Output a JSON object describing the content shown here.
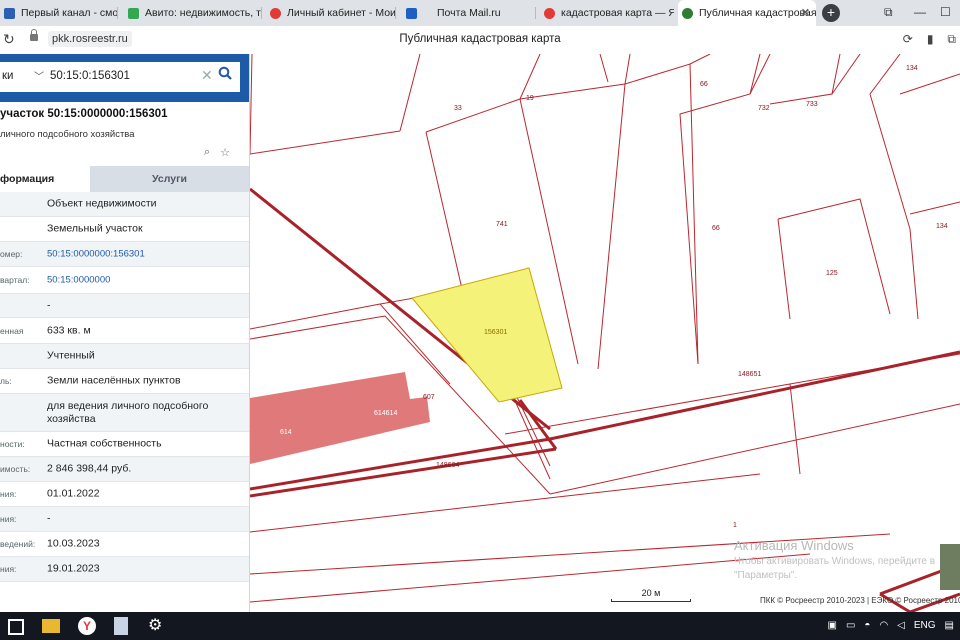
{
  "browser": {
    "tabs": [
      {
        "label": "Первый канал - смо",
        "color": "#2b5fb4"
      },
      {
        "label": "Авито: недвижимость, тр",
        "color": "#33a852"
      },
      {
        "label": "Личный кабинет - Мои о",
        "color": "#e03b3b"
      },
      {
        "label": "Почта Mail.ru",
        "color": "#1f5fc4"
      },
      {
        "label": "кадастровая карта — Янд",
        "color": "#e53935"
      },
      {
        "label": "Публичная кадастровая",
        "color": "#2e7d32",
        "active": true
      }
    ],
    "url": "pkk.rosreestr.ru",
    "page_title": "Публичная кадастровая карта"
  },
  "search": {
    "type_label": "ки",
    "value": "50:15:0:156301"
  },
  "object": {
    "title": "участок 50:15:0000000:156301",
    "subtitle": "личного подсобного хозяйства"
  },
  "panel_tabs": {
    "info": "формация",
    "services": "Услуги"
  },
  "rows": [
    {
      "label": "",
      "value": "Объект недвижимости",
      "link": false,
      "h": 25
    },
    {
      "label": "",
      "value": "Земельный участок",
      "link": false,
      "h": 25
    },
    {
      "label": "омер:",
      "value": "50:15:0000000:156301",
      "link": true,
      "h": 25
    },
    {
      "label": "вартал:",
      "value": "50:15:0000000",
      "link": true,
      "h": 27
    },
    {
      "label": "",
      "value": "-",
      "link": false,
      "h": 24
    },
    {
      "label": "енная",
      "value": "633 кв. м",
      "link": false,
      "h": 26
    },
    {
      "label": "",
      "value": "Учтенный",
      "link": false,
      "h": 25
    },
    {
      "label": "ль:",
      "value": "Земли населённых пунктов",
      "link": false,
      "h": 25
    },
    {
      "label": "",
      "value": "для ведения личного подсобного хозяйства",
      "link": false,
      "h": 38
    },
    {
      "label": "ности:",
      "value": "Частная собственность",
      "link": false,
      "h": 25
    },
    {
      "label": "имость:",
      "value": "2 846 398,44 руб.",
      "link": false,
      "h": 25
    },
    {
      "label": "ния:",
      "value": "01.01.2022",
      "link": false,
      "h": 25
    },
    {
      "label": "ния:",
      "value": "-",
      "link": false,
      "h": 25
    },
    {
      "label": "ведений:",
      "value": "10.03.2023",
      "link": false,
      "h": 25
    },
    {
      "label": "ния:",
      "value": "19.01.2023",
      "link": false,
      "h": 25
    }
  ],
  "map": {
    "parcel_labels": [
      "33",
      "19",
      "66",
      "732",
      "733",
      "134",
      "741",
      "66",
      "134",
      "125",
      "156301",
      "148651",
      "607",
      "614614",
      "614",
      "148664",
      "1"
    ],
    "scale_label": "20 м",
    "attribution": "ПКК © Росреестр 2010-2023 | ЕЭКО © Росреестр 2010-2",
    "watermark_title": "Активация Windows",
    "watermark_line1": "Чтобы активировать Windows, перейдите в",
    "watermark_line2": "\"Параметры\".",
    "colors": {
      "selected_parcel": "#f5f27a",
      "building": "#e07a7a",
      "boundary": "#b8282e"
    }
  },
  "taskbar": {
    "tray_lang": "ENG"
  }
}
